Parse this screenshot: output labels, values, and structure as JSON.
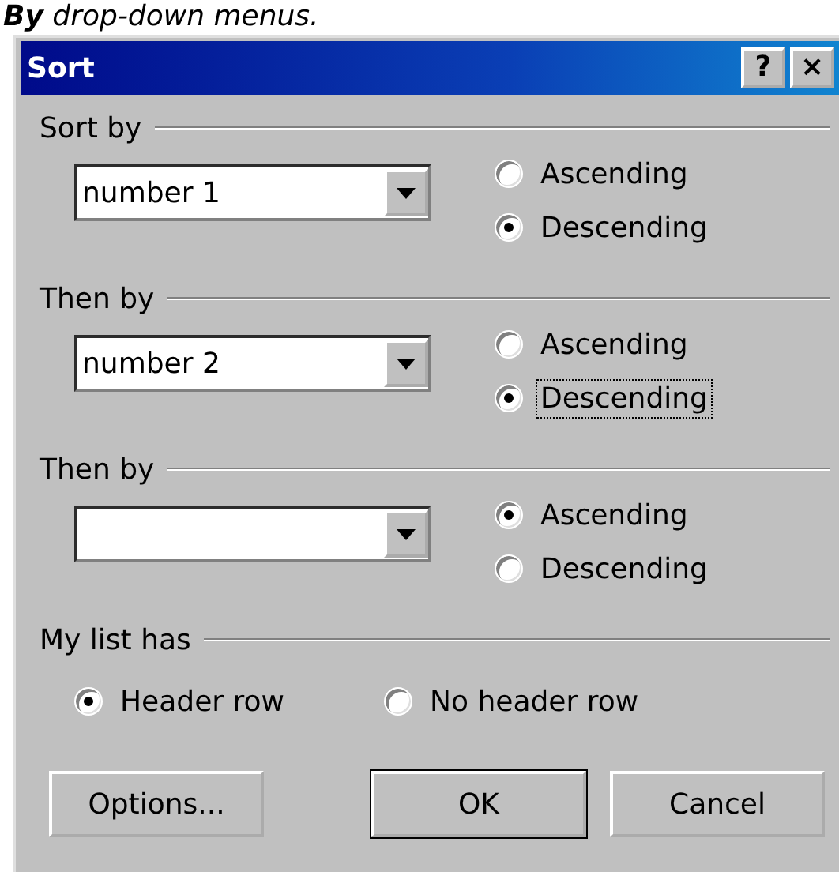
{
  "caption": "**By** drop-down menus.",
  "window": {
    "title": "Sort",
    "title_buttons": [
      "?",
      "×"
    ]
  },
  "groups": [
    {
      "label": "Sort by",
      "combo": {
        "value": "number 1"
      },
      "options": [
        {
          "label": "Ascending",
          "selected": false,
          "focused": false
        },
        {
          "label": "Descending",
          "selected": true,
          "focused": false
        }
      ]
    },
    {
      "label": "Then by",
      "combo": {
        "value": "number 2"
      },
      "options": [
        {
          "label": "Ascending",
          "selected": false,
          "focused": false
        },
        {
          "label": "Descending",
          "selected": true,
          "focused": true
        }
      ]
    },
    {
      "label": "Then by",
      "options": [
        {
          "label": "Ascending",
          "selected": true,
          "focused": false
        },
        {
          "label": "Descending",
          "selected": false,
          "focused": false
        }
      ]
    }
  ],
  "list_has": {
    "label": "My list has",
    "options": [
      {
        "label": "Header row",
        "selected": true
      },
      {
        "label": "No header row",
        "selected": false
      }
    ]
  },
  "buttons": [
    {
      "label": "Options...",
      "default": false
    },
    {
      "label": "OK",
      "default": true
    },
    {
      "label": "Cancel",
      "default": false
    }
  ]
}
